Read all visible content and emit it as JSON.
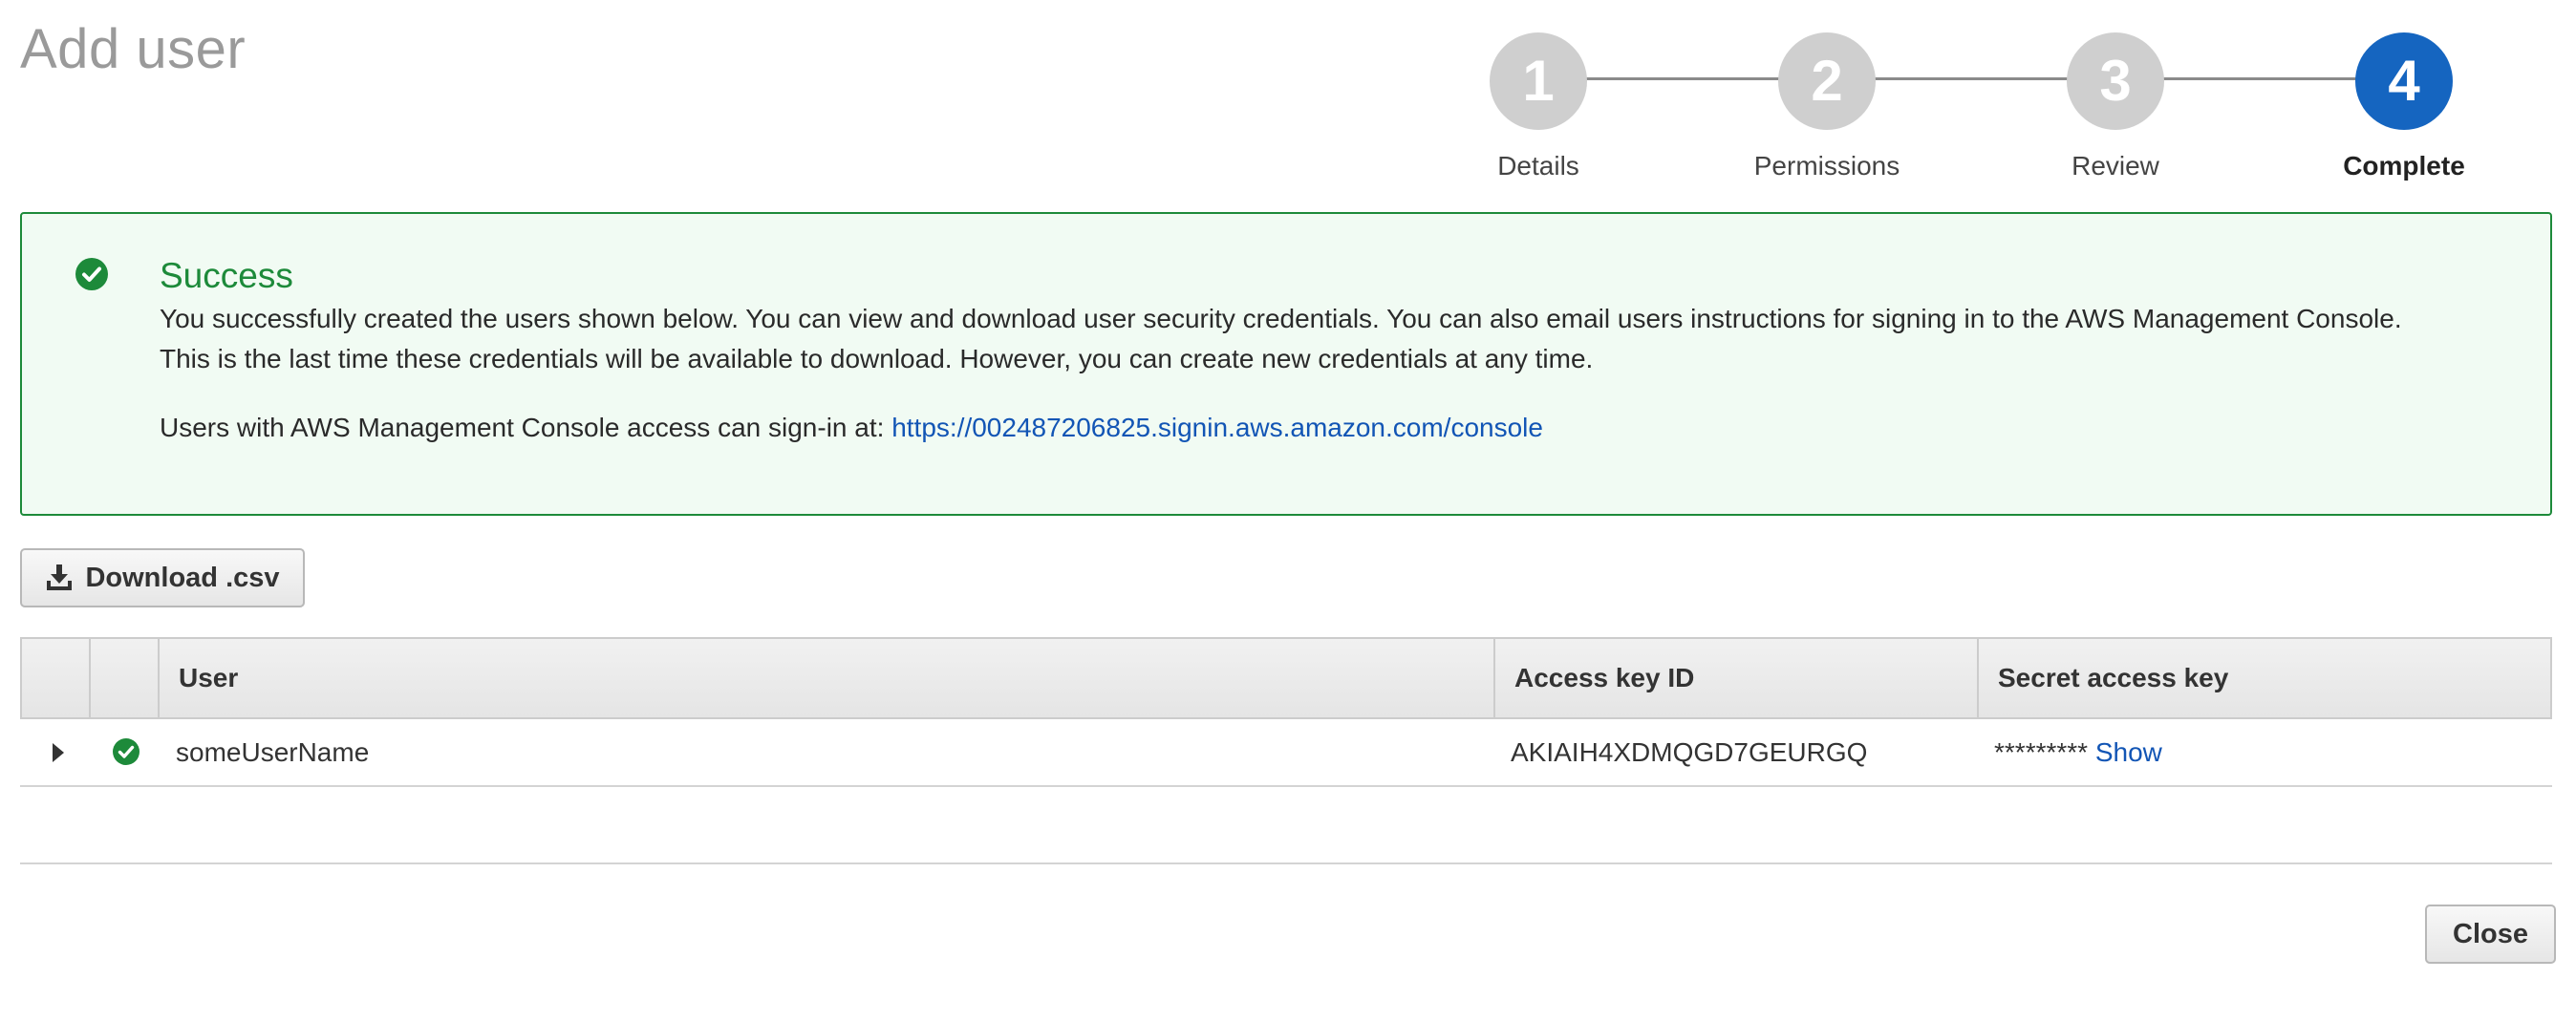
{
  "page": {
    "title": "Add user"
  },
  "stepper": {
    "steps": [
      {
        "number": "1",
        "label": "Details",
        "state": "done"
      },
      {
        "number": "2",
        "label": "Permissions",
        "state": "done"
      },
      {
        "number": "3",
        "label": "Review",
        "state": "done"
      },
      {
        "number": "4",
        "label": "Complete",
        "state": "active"
      }
    ],
    "active_color": "#1565c0",
    "inactive_color": "#cfcfcf"
  },
  "success": {
    "icon": "check-circle-icon",
    "title": "Success",
    "line1": "You successfully created the users shown below. You can view and download user security credentials. You can also email users instructions for signing in to the AWS Management Console.",
    "line2": "This is the last time these credentials will be available to download. However, you can create new credentials at any time.",
    "signin_prefix": "Users with AWS Management Console access can sign-in at: ",
    "signin_url": "https://002487206825.signin.aws.amazon.com/console",
    "color": "#1d8a3a"
  },
  "toolbar": {
    "download_icon": "download-icon",
    "download_label": "Download .csv"
  },
  "table": {
    "columns": [
      "",
      "",
      "User",
      "Access key ID",
      "Secret access key"
    ],
    "rows": [
      {
        "expand_icon": "caret-right-icon",
        "status_icon": "check-circle-icon",
        "user": "someUserName",
        "access_key_id": "AKIAIH4XDMQGD7GEURGQ",
        "secret_masked": "*********",
        "secret_show_label": "Show"
      }
    ]
  },
  "footer": {
    "close_label": "Close"
  }
}
